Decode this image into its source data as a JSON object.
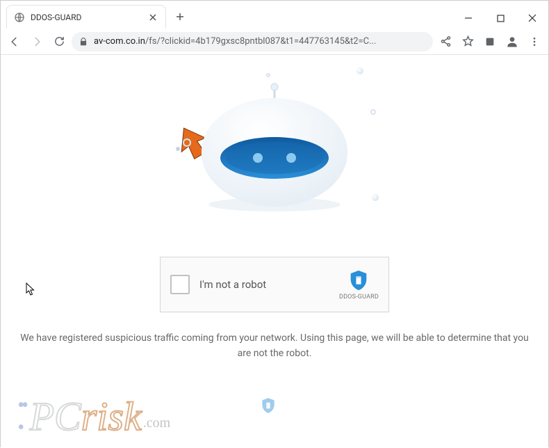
{
  "window": {
    "tab_title": "DDOS-GUARD"
  },
  "toolbar": {
    "url_host": "av-com.co.in",
    "url_rest": "/fs/?clickid=4b179gxsc8pntbl087&t1=447763145&t2=C..."
  },
  "captcha": {
    "checkbox_label": "I'm not a robot",
    "brand": "DDOS-GUARD"
  },
  "message": "We have registered suspicious traffic coming from your network. Using this page, we will be able to determine that you are not the robot.",
  "watermark": {
    "pc": "PC",
    "risk": "risk",
    "dotcom": ".com"
  },
  "colors": {
    "shield": "#2a8fd8",
    "accent": "#e56a1c"
  }
}
